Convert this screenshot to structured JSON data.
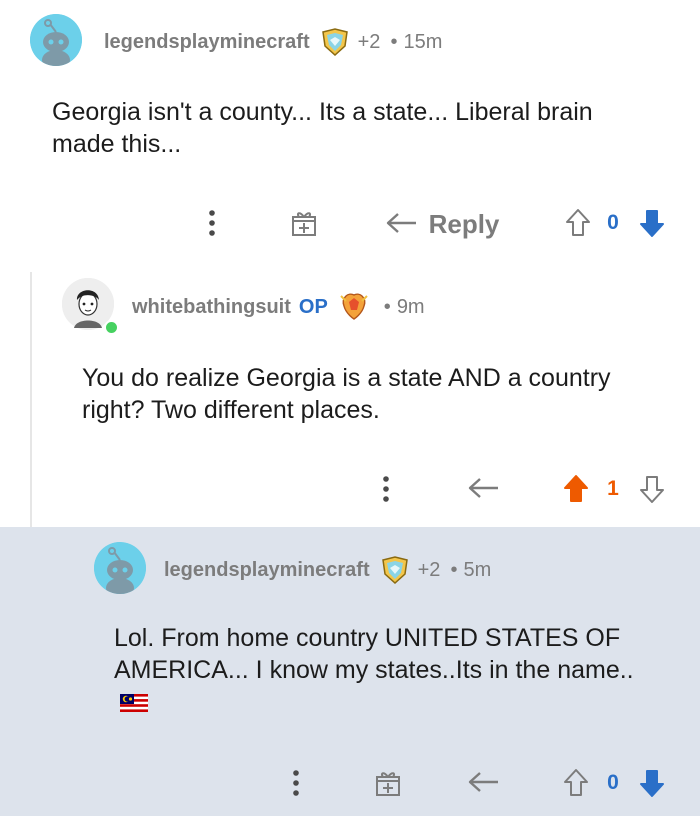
{
  "comments": [
    {
      "username": "legendsplayminecraft",
      "award_count": "+2",
      "time": "15m",
      "body": "Georgia isn't a county... Its a state... Liberal brain made this...",
      "vote_count": "0",
      "reply_label": "Reply",
      "vote_state": "downvoted"
    },
    {
      "username": "whitebathingsuit",
      "op_label": "OP",
      "time": "9m",
      "body": "You do realize Georgia is a state AND a country right? Two different places.",
      "vote_count": "1",
      "vote_state": "upvoted",
      "online": true
    },
    {
      "username": "legendsplayminecraft",
      "award_count": "+2",
      "time": "5m",
      "body": "Lol. From home country UNITED STATES OF AMERICA... I know my states..Its in the name..",
      "vote_count": "0",
      "vote_state": "downvoted",
      "highlighted": true
    }
  ],
  "icons": {
    "more": "more-vertical-icon",
    "award": "gift-icon",
    "reply": "reply-arrow-icon",
    "upvote": "upvote-arrow-icon",
    "downvote": "downvote-arrow-icon",
    "flag": "malaysia-flag-emoji"
  },
  "colors": {
    "upvote": "#ee5a00",
    "downvote": "#2a6fc8",
    "meta": "#7c7c7c",
    "highlight_bg": "#dde3ec",
    "online": "#46d160"
  }
}
